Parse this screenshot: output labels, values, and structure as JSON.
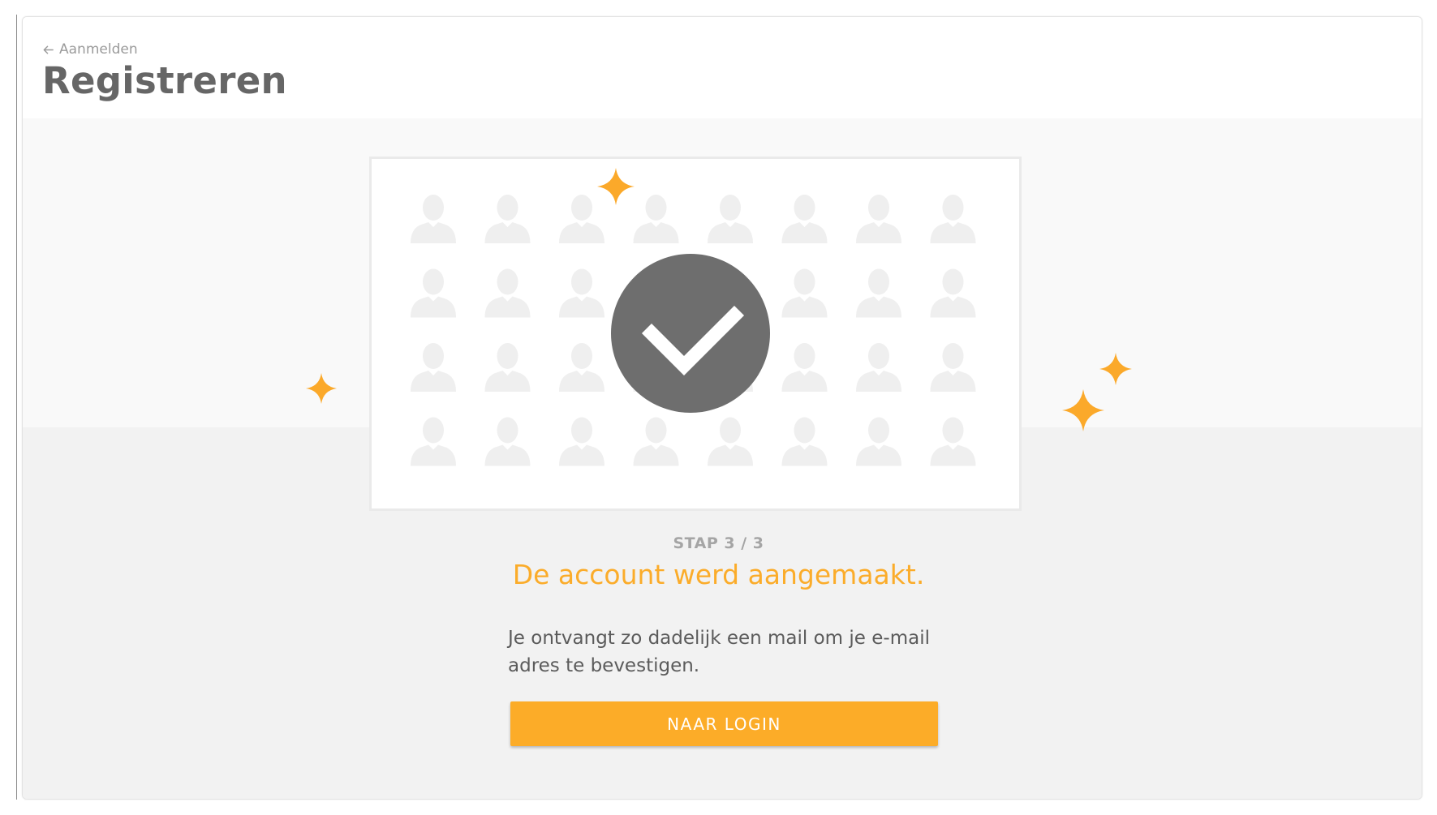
{
  "header": {
    "back_label": "Aanmelden",
    "title": "Registreren"
  },
  "status": {
    "step": "STAP 3 / 3",
    "message": "De account werd aangemaakt.",
    "info": "Je ontvangt zo dadelijk een mail om je e-mail adres te bevestigen."
  },
  "actions": {
    "login_label": "NAAR LOGIN"
  },
  "icons": {
    "back": "arrow-left-icon",
    "check": "checkmark-icon",
    "sparkle": "sparkle-icon",
    "person": "person-silhouette-icon"
  },
  "colors": {
    "accent": "#fcac28",
    "title": "#666666",
    "check_circle": "#6e6e6e",
    "silhouette": "#efefef"
  }
}
